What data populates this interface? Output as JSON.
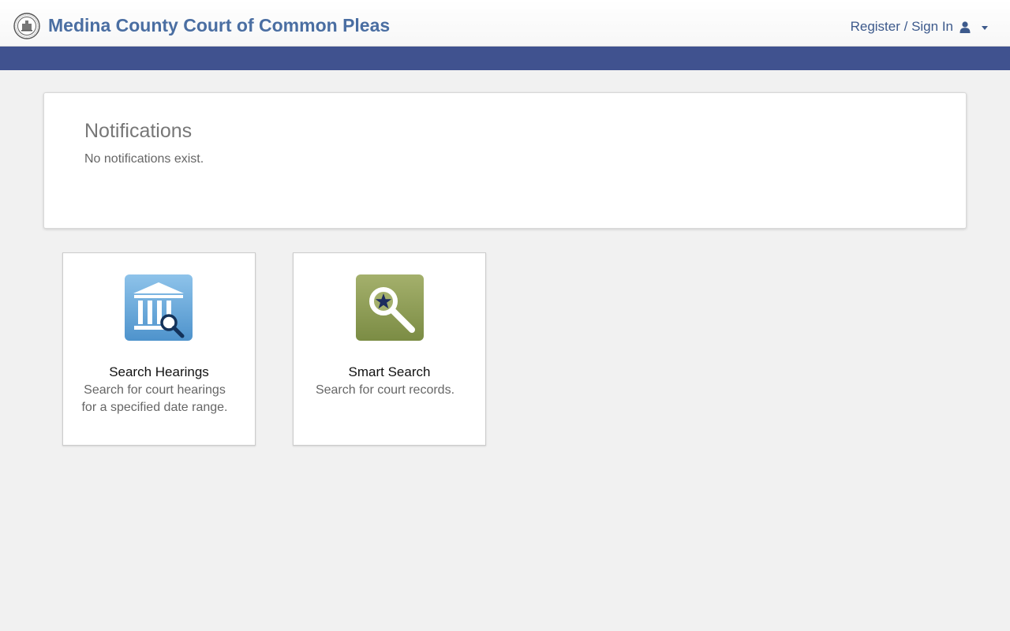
{
  "header": {
    "site_title": "Medina County Court of Common Pleas",
    "signin_label": "Register / Sign In"
  },
  "colors": {
    "nav_bar": "#40528f",
    "brand_text": "#4a6ea2",
    "hearings_icon": "#5b9fd3",
    "smart_search_icon": "#8a9a53"
  },
  "notifications": {
    "title": "Notifications",
    "message": "No notifications exist."
  },
  "tiles": [
    {
      "icon": "courthouse-search-icon",
      "title": "Search Hearings",
      "description_line1": "Search for court hearings",
      "description_line2": "for a specified date range."
    },
    {
      "icon": "star-magnifier-icon",
      "title": "Smart Search",
      "description_line1": "Search for court records."
    }
  ]
}
